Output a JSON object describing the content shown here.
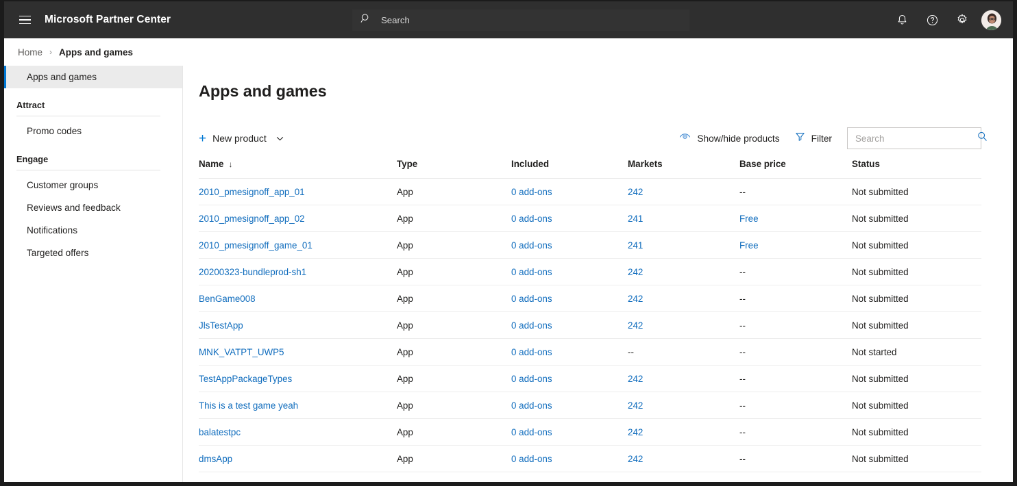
{
  "topbar": {
    "menu_icon": "hamburger-icon",
    "brand": "Microsoft Partner Center",
    "search_placeholder": "Search",
    "search_value": "",
    "search_icon": "search-icon",
    "icons": [
      {
        "name": "notifications-icon",
        "glyph": "bell"
      },
      {
        "name": "help-icon",
        "glyph": "question-circle"
      },
      {
        "name": "settings-icon",
        "glyph": "gear"
      }
    ],
    "avatar_label": "account-avatar"
  },
  "breadcrumb": {
    "home": "Home",
    "separator": "›",
    "current": "Apps and games"
  },
  "sidebar": {
    "active_item": "Apps and games",
    "groups": [
      {
        "title": "Attract",
        "items": [
          "Promo codes"
        ]
      },
      {
        "title": "Engage",
        "items": [
          "Customer groups",
          "Reviews and feedback",
          "Notifications",
          "Targeted offers"
        ]
      }
    ]
  },
  "main": {
    "title": "Apps and games",
    "toolbar": {
      "new_product_label": "New product",
      "new_product_plus": "+",
      "new_product_chevron": "chevron-down-icon",
      "show_hide_label": "Show/hide products",
      "show_hide_icon": "eye-icon",
      "filter_label": "Filter",
      "filter_icon": "funnel-icon",
      "search_placeholder": "Search",
      "search_value": "",
      "search_icon": "search-icon"
    },
    "table": {
      "columns": [
        {
          "label": "Name",
          "sort": "↓"
        },
        {
          "label": "Type",
          "sort": ""
        },
        {
          "label": "Included",
          "sort": ""
        },
        {
          "label": "Markets",
          "sort": ""
        },
        {
          "label": "Base price",
          "sort": ""
        },
        {
          "label": "Status",
          "sort": ""
        }
      ],
      "rows": [
        {
          "name": "2010_pmesignoff_app_01",
          "type": "App",
          "included": "0 add-ons",
          "markets": "242",
          "price": "--",
          "price_link": false,
          "markets_link": true,
          "status": "Not submitted"
        },
        {
          "name": "2010_pmesignoff_app_02",
          "type": "App",
          "included": "0 add-ons",
          "markets": "241",
          "price": "Free",
          "price_link": true,
          "markets_link": true,
          "status": "Not submitted"
        },
        {
          "name": "2010_pmesignoff_game_01",
          "type": "App",
          "included": "0 add-ons",
          "markets": "241",
          "price": "Free",
          "price_link": true,
          "markets_link": true,
          "status": "Not submitted"
        },
        {
          "name": "20200323-bundleprod-sh1",
          "type": "App",
          "included": "0 add-ons",
          "markets": "242",
          "price": "--",
          "price_link": false,
          "markets_link": true,
          "status": "Not submitted"
        },
        {
          "name": "BenGame008",
          "type": "App",
          "included": "0 add-ons",
          "markets": "242",
          "price": "--",
          "price_link": false,
          "markets_link": true,
          "status": "Not submitted"
        },
        {
          "name": "JlsTestApp",
          "type": "App",
          "included": "0 add-ons",
          "markets": "242",
          "price": "--",
          "price_link": false,
          "markets_link": true,
          "status": "Not submitted"
        },
        {
          "name": "MNK_VATPT_UWP5",
          "type": "App",
          "included": "0 add-ons",
          "markets": "--",
          "price": "--",
          "price_link": false,
          "markets_link": false,
          "status": "Not started"
        },
        {
          "name": "TestAppPackageTypes",
          "type": "App",
          "included": "0 add-ons",
          "markets": "242",
          "price": "--",
          "price_link": false,
          "markets_link": true,
          "status": "Not submitted"
        },
        {
          "name": "This is a test game yeah",
          "type": "App",
          "included": "0 add-ons",
          "markets": "242",
          "price": "--",
          "price_link": false,
          "markets_link": true,
          "status": "Not submitted"
        },
        {
          "name": "balatestpc",
          "type": "App",
          "included": "0 add-ons",
          "markets": "242",
          "price": "--",
          "price_link": false,
          "markets_link": true,
          "status": "Not submitted"
        },
        {
          "name": "dmsApp",
          "type": "App",
          "included": "0 add-ons",
          "markets": "242",
          "price": "--",
          "price_link": false,
          "markets_link": true,
          "status": "Not submitted"
        }
      ]
    }
  },
  "colors": {
    "topbar_bg": "#2f2f2f",
    "accent": "#0078d4",
    "link": "#0f6cbd",
    "active_nav_bg": "#ebebeb",
    "text": "#201f1e"
  }
}
